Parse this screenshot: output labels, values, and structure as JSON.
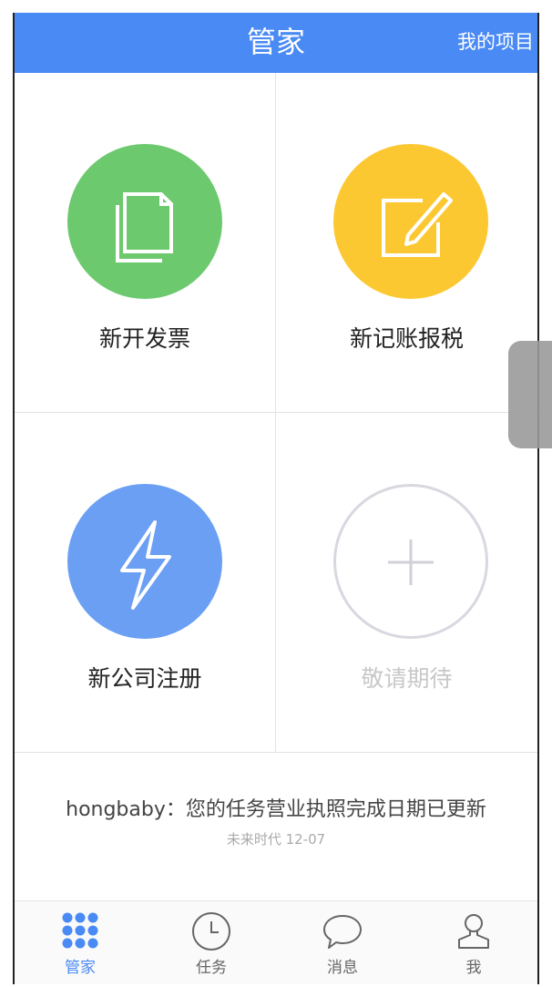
{
  "header": {
    "title": "管家",
    "right_link": "我的项目",
    "bg_color": "#4a8af4"
  },
  "grid": [
    {
      "label": "新开发票",
      "icon": "documents-icon",
      "color": "#6cc96e"
    },
    {
      "label": "新记账报税",
      "icon": "edit-pencil-icon",
      "color": "#fcc832"
    },
    {
      "label": "新公司注册",
      "icon": "lightning-icon",
      "color": "#6a9ff4"
    },
    {
      "label": "敬请期待",
      "icon": "plus-icon",
      "color": "#d8d8e0"
    }
  ],
  "notice": {
    "message": "hongbaby：您的任务营业执照完成日期已更新",
    "meta": "未来时代 12-07"
  },
  "tabbar": [
    {
      "label": "管家",
      "icon": "grid-dots-icon",
      "active": true
    },
    {
      "label": "任务",
      "icon": "clock-icon",
      "active": false
    },
    {
      "label": "消息",
      "icon": "chat-bubble-icon",
      "active": false
    },
    {
      "label": "我",
      "icon": "person-icon",
      "active": false
    }
  ]
}
